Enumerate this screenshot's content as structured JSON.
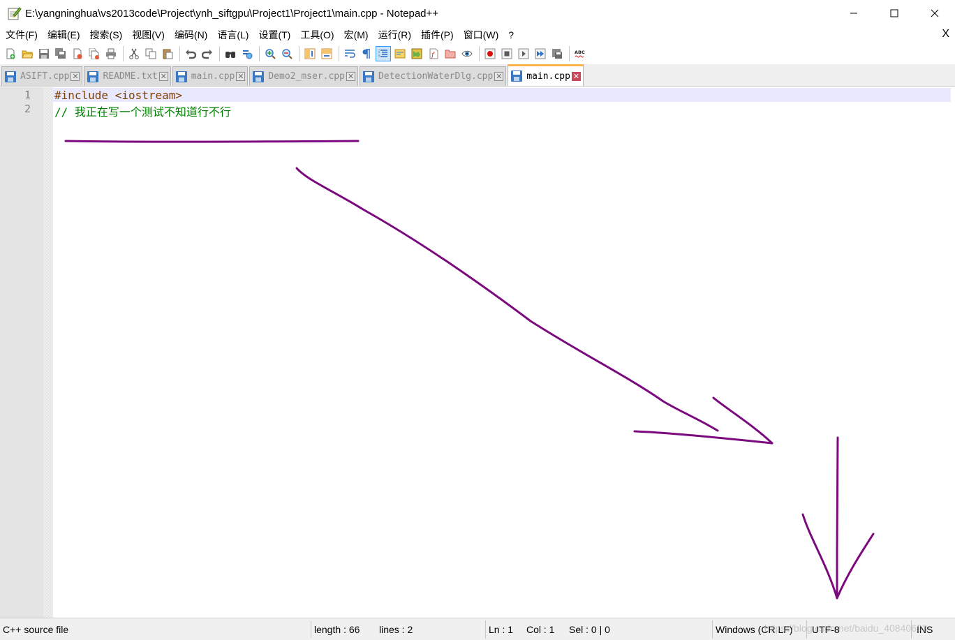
{
  "window": {
    "title": "E:\\yangninghua\\vs2013code\\Project\\ynh_siftgpu\\Project1\\Project1\\main.cpp - Notepad++",
    "minimize": "—",
    "maximize": "☐",
    "close": "✕"
  },
  "menu": {
    "items": [
      "文件(F)",
      "编辑(E)",
      "搜索(S)",
      "视图(V)",
      "编码(N)",
      "语言(L)",
      "设置(T)",
      "工具(O)",
      "宏(M)",
      "运行(R)",
      "插件(P)",
      "窗口(W)",
      "?"
    ],
    "close": "X"
  },
  "toolbar": {
    "spellcheck_label": "ABC"
  },
  "tabs": [
    {
      "label": "ASIFT.cpp",
      "active": false
    },
    {
      "label": "README.txt",
      "active": false
    },
    {
      "label": "main.cpp",
      "active": false
    },
    {
      "label": "Demo2_mser.cpp",
      "active": false
    },
    {
      "label": "DetectionWaterDlg.cpp",
      "active": false
    },
    {
      "label": "main.cpp",
      "active": true
    }
  ],
  "tab_close_glyph": "✕",
  "editor": {
    "line_numbers": [
      "1",
      "2"
    ],
    "lines": [
      {
        "text": "#include <iostream>",
        "kind": "preprocessor"
      },
      {
        "text": "// 我正在写一个测试不知道行不行",
        "kind": "comment"
      }
    ]
  },
  "annotation_color": "#7b0a7e",
  "status": {
    "file_type": "C++ source file",
    "length": "length : 66",
    "lines": "lines : 2",
    "ln": "Ln : 1",
    "col": "Col : 1",
    "sel": "Sel : 0 | 0",
    "eol": "Windows (CR LF)",
    "encoding": "UTF-8",
    "mode": "INS"
  },
  "watermark": "https://blog.csdn.net/baidu_40840693"
}
